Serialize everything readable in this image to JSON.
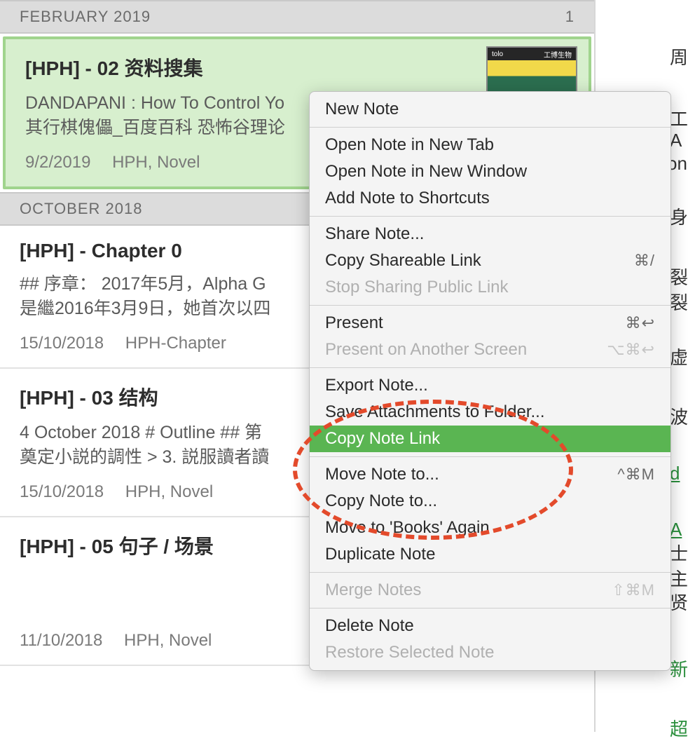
{
  "sections": {
    "feb2019": {
      "label": "FEBRUARY 2019",
      "count": "1"
    },
    "oct2018": {
      "label": "OCTOBER 2018"
    }
  },
  "notes": {
    "hph02": {
      "title": "[HPH] - 02 资料搜集",
      "snippet": "DANDAPANI : How To Control Yo\n其行棋傀儡_百度百科 恐怖谷理论",
      "date": "9/2/2019",
      "tags": "HPH, Novel"
    },
    "hph_ch0": {
      "title": "[HPH] - Chapter 0",
      "snippet": "## 序章：  2017年5月，Alpha G\n是繼2016年3月9日，她首次以四",
      "date": "15/10/2018",
      "tags": "HPH-Chapter"
    },
    "hph03": {
      "title": "[HPH] - 03 结构",
      "snippet": "4 October 2018 # Outline ## 第\n奠定小説的調性 > 3. 説服讀者讀",
      "date": "15/10/2018",
      "tags": "HPH, Novel"
    },
    "hph05": {
      "title": "[HPH] - 05 句子 / 场景",
      "snippet": "",
      "date": "11/10/2018",
      "tags": "HPH, Novel"
    }
  },
  "thumb": {
    "left": "tolo",
    "right": "工博生物"
  },
  "menu": {
    "new_note": "New Note",
    "open_tab": "Open Note in New Tab",
    "open_window": "Open Note in New Window",
    "add_shortcuts": "Add Note to Shortcuts",
    "share": "Share Note...",
    "copy_shareable": "Copy Shareable Link",
    "copy_shareable_sc": "⌘/",
    "stop_sharing": "Stop Sharing Public Link",
    "present": "Present",
    "present_sc": "⌘↩",
    "present_other": "Present on Another Screen",
    "present_other_sc": "⌥⌘↩",
    "export": "Export Note...",
    "save_attach": "Save Attachments to Folder...",
    "copy_link": "Copy Note Link",
    "move_to": "Move Note to...",
    "move_to_sc": "^⌘M",
    "copy_to": "Copy Note to...",
    "move_books": "Move to 'Books' Again",
    "duplicate": "Duplicate Note",
    "merge": "Merge Notes",
    "merge_sc": "⇧⌘M",
    "delete": "Delete Note",
    "restore": "Restore Selected Note"
  },
  "hints": {
    "h1": "周",
    "h2": "工",
    "h3": "A",
    "h4": "on",
    "h5": "身",
    "h6": "裂",
    "h7": "裂",
    "h8": "虚",
    "h9": "波",
    "h10": "d",
    "h11": "A",
    "h12": "士",
    "h13": "主",
    "h14": "贤",
    "h15": "新",
    "h16": "超"
  }
}
